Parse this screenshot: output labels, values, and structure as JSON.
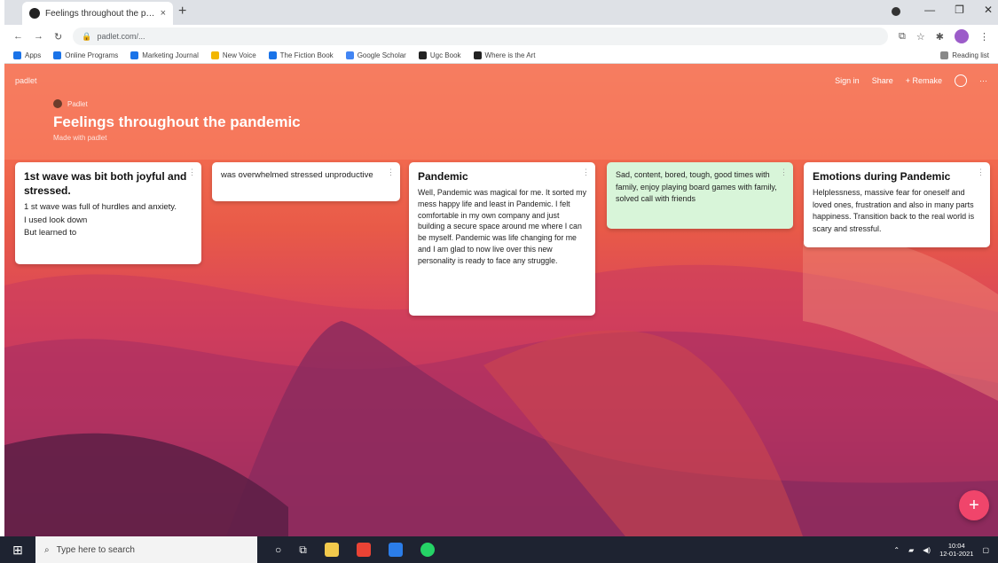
{
  "browser": {
    "tab_title": "Feelings throughout the pandemic",
    "close_tab": "×",
    "new_tab": "+",
    "url": "padlet.com/...",
    "window_controls": [
      "—",
      "❐",
      "✕"
    ]
  },
  "bookmarks": {
    "items": [
      {
        "label": "Apps",
        "icon": "apps-grid-icon"
      },
      {
        "label": "Online Programs"
      },
      {
        "label": "Marketing Journal"
      },
      {
        "label": "New Voice"
      },
      {
        "label": "The Fiction Book"
      },
      {
        "label": "Google Scholar"
      },
      {
        "label": "Ugc Book"
      },
      {
        "label": "Where is the Art"
      }
    ],
    "reading_list": "Reading list"
  },
  "page": {
    "brand": "padlet",
    "header_right": [
      "Sign in",
      "Share",
      "+ Remake"
    ],
    "crumb": "Padlet",
    "title": "Feelings throughout the pandemic",
    "subtitle": "Made with padlet"
  },
  "cards": [
    {
      "title": "1st wave was bit both joyful and stressed.",
      "body": "1 st wave was full of hurdles and anxiety.\nI used look down\nBut learned to"
    },
    {
      "title": "",
      "body": "was overwhelmed stressed unproductive"
    },
    {
      "title": "Pandemic",
      "body": "Well, Pandemic was magical for me. It sorted my mess happy life and least in Pandemic. I felt comfortable in my own company and just building a secure space around me where I can be myself. Pandemic was life changing for me and I am glad to now live over this new personality is ready to face any struggle."
    },
    {
      "title": "",
      "body": "Sad, content, bored, tough, good times with family, enjoy playing board games with family, solved call with friends"
    },
    {
      "title": "Emotions during Pandemic",
      "body": "Helplessness, massive fear for oneself and loved ones, frustration and also in many parts happiness. Transition back to the real world is scary and stressful."
    }
  ],
  "fab_label": "+",
  "taskbar": {
    "search_placeholder": "Type here to search",
    "time": "10:04",
    "date": "12-01-2021"
  },
  "colors": {
    "fab": "#f0456b",
    "green_card": "#d8f5d9"
  }
}
